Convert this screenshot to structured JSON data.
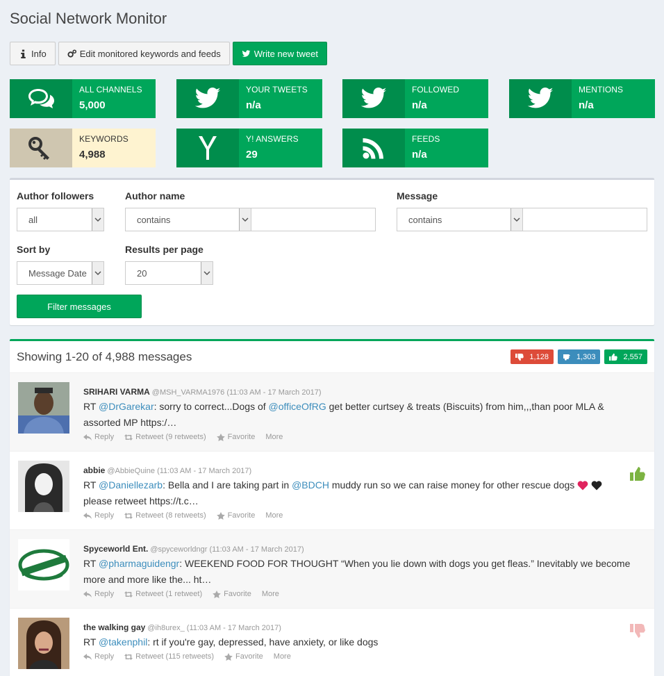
{
  "page": {
    "title": "Social Network Monitor"
  },
  "toolbar": {
    "info_label": "Info",
    "edit_label": "Edit monitored keywords and feeds",
    "tweet_label": "Write new tweet"
  },
  "tiles": [
    {
      "label": "ALL CHANNELS",
      "value": "5,000",
      "icon": "comments-icon"
    },
    {
      "label": "YOUR TWEETS",
      "value": "n/a",
      "icon": "twitter-icon"
    },
    {
      "label": "FOLLOWED",
      "value": "n/a",
      "icon": "twitter-icon"
    },
    {
      "label": "MENTIONS",
      "value": "n/a",
      "icon": "twitter-icon"
    },
    {
      "label": "KEYWORDS",
      "value": "4,988",
      "icon": "key-icon"
    },
    {
      "label": "Y! ANSWERS",
      "value": "29",
      "icon": "yahoo-icon"
    },
    {
      "label": "FEEDS",
      "value": "n/a",
      "icon": "rss-icon"
    }
  ],
  "filters": {
    "author_followers": {
      "label": "Author followers",
      "value": "all"
    },
    "author_name": {
      "label": "Author name",
      "mode": "contains",
      "value": ""
    },
    "message": {
      "label": "Message",
      "mode": "contains",
      "value": ""
    },
    "sort_by": {
      "label": "Sort by",
      "value": "Message Date"
    },
    "results_per_page": {
      "label": "Results per page",
      "value": "20"
    },
    "button_label": "Filter messages"
  },
  "messages_box": {
    "heading": "Showing 1-20 of 4,988 messages",
    "counts": {
      "negative": "1,128",
      "neutral": "1,303",
      "positive": "2,557"
    }
  },
  "messages": [
    {
      "author": "SRIHARI VARMA",
      "handle": "@MSH_VARMA1976",
      "time": "(11:03 AM - 17 March 2017)",
      "text_parts": [
        "RT ",
        "@DrGarekar",
        ": sorry to correct...Dogs of ",
        "@officeOfRG",
        " get better curtsey & treats (Biscuits) from him,,,than poor MLA & assorted MP https:/…"
      ],
      "retweet": "Retweet (9 retweets)",
      "sentiment": "none"
    },
    {
      "author": "abbie",
      "handle": "@AbbieQuine",
      "time": "(11:03 AM - 17 March 2017)",
      "text_parts": [
        "RT ",
        "@Daniellezarb",
        ": Bella and I are taking part in ",
        "@BDCH",
        " muddy run so we can raise money for other rescue dogs ",
        "",
        " please retweet https://t.c…"
      ],
      "retweet": "Retweet (8 retweets)",
      "sentiment": "positive"
    },
    {
      "author": "Spyceworld Ent.",
      "handle": "@spyceworldngr",
      "time": "(11:03 AM - 17 March 2017)",
      "text_parts": [
        "RT ",
        "@pharmaguidengr",
        ": WEEKEND FOOD FOR THOUGHT “When you lie down with dogs you get fleas.” Inevitably we become more and more like the... ht…"
      ],
      "retweet": "Retweet (1 retweet)",
      "sentiment": "none"
    },
    {
      "author": "the walking gay",
      "handle": "@ih8urex_",
      "time": "(11:03 AM - 17 March 2017)",
      "text_parts": [
        "RT ",
        "@takenphil",
        ": rt if you're gay, depressed, have anxiety, or like dogs"
      ],
      "retweet": "Retweet (115 retweets)",
      "sentiment": "negative"
    }
  ],
  "actions": {
    "reply": "Reply",
    "favorite": "Favorite",
    "more": "More"
  },
  "colors": {
    "green": "#00a65a",
    "green_dark": "#008d4c",
    "red": "#dd4b39",
    "blue": "#3c8dbc",
    "keyword_bg": "#fef3d0"
  }
}
